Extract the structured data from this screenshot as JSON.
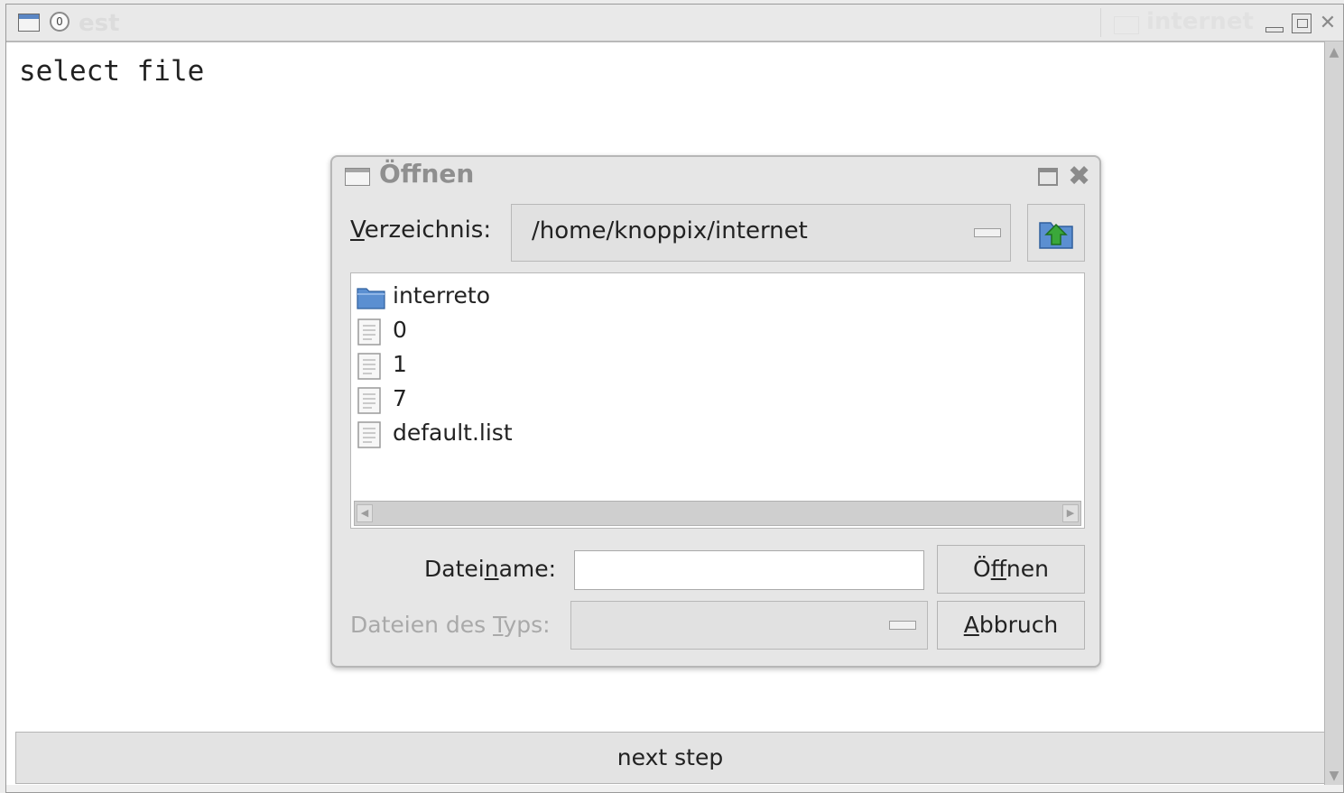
{
  "main_window": {
    "badge": "0",
    "faded_title": "est",
    "faded_tab_title": "internet",
    "prompt": "select file",
    "next_button": "next step"
  },
  "dialog": {
    "title": "Öffnen",
    "directory": {
      "label_mnemonic": "V",
      "label_rest": "erzeichnis:",
      "value": "/home/knoppix/internet"
    },
    "files": [
      {
        "name": "interreto",
        "icon": "folder-icon"
      },
      {
        "name": "0",
        "icon": "file-icon"
      },
      {
        "name": "1",
        "icon": "file-icon"
      },
      {
        "name": "7",
        "icon": "file-icon"
      },
      {
        "name": "default.list",
        "icon": "file-icon"
      }
    ],
    "filename": {
      "label_pre": "Datei",
      "label_mnemonic": "n",
      "label_post": "ame:",
      "value": ""
    },
    "filetype": {
      "label_pre": "Dateien des ",
      "label_mnemonic": "T",
      "label_post": "yps:",
      "value": ""
    },
    "open_button": {
      "pre": "Ö",
      "mnemonic": "f",
      "post": "fnen"
    },
    "cancel_button": {
      "mnemonic": "A",
      "post": "bbruch"
    }
  },
  "colors": {
    "folder": "#5b8fd1",
    "up_arrow": "#3aa83a",
    "title_accent": "#5a86c4"
  }
}
